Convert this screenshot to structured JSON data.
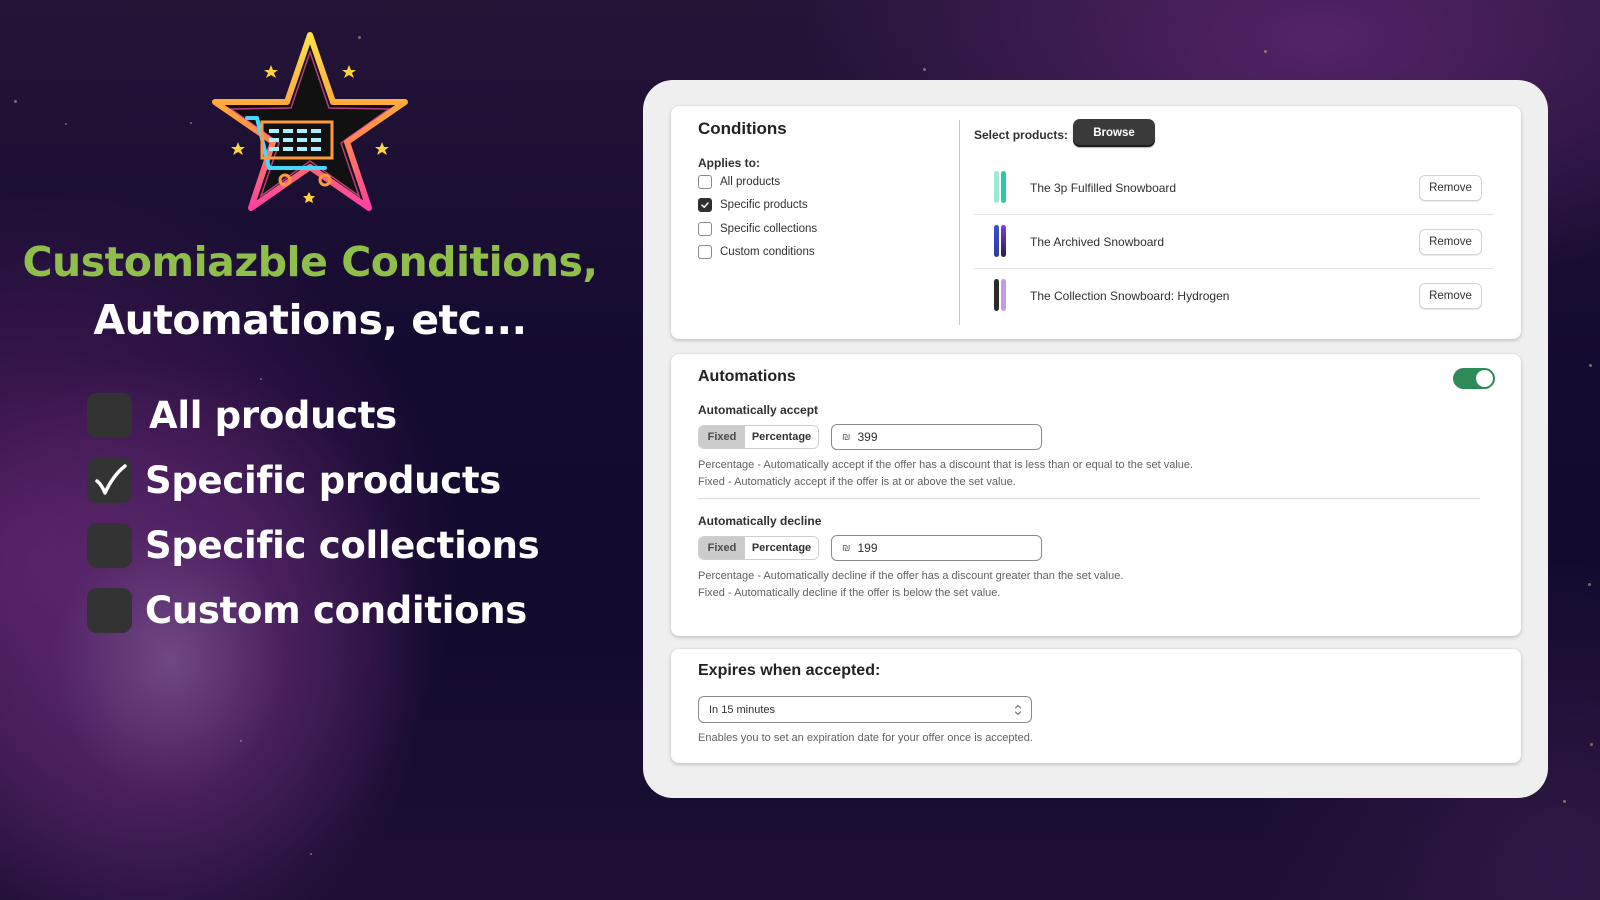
{
  "promo": {
    "headline_line1": "Customiazble Conditions,",
    "headline_line2": "Automations, etc...",
    "accent_color": "#8fbf4a",
    "items": [
      {
        "label": "All products",
        "checked": false
      },
      {
        "label": "Specific products",
        "checked": true
      },
      {
        "label": "Specific collections",
        "checked": false
      },
      {
        "label": "Custom conditions",
        "checked": false
      }
    ]
  },
  "conditions": {
    "title": "Conditions",
    "applies_to_label": "Applies to:",
    "options": [
      {
        "label": "All products",
        "checked": false
      },
      {
        "label": "Specific products",
        "checked": true
      },
      {
        "label": "Specific collections",
        "checked": false
      },
      {
        "label": "Custom conditions",
        "checked": false
      }
    ],
    "select_products_label": "Select products:",
    "browse_label": "Browse",
    "products": [
      {
        "name": "The 3p Fulfilled Snowboard",
        "remove_label": "Remove",
        "colors": [
          "#9ae8d8",
          "#2ccaa4"
        ]
      },
      {
        "name": "The Archived Snowboard",
        "remove_label": "Remove",
        "colors": [
          "#3a4fc9",
          "#5a2fb0"
        ]
      },
      {
        "name": "The Collection Snowboard: Hydrogen",
        "remove_label": "Remove",
        "colors": [
          "#2b2b2b",
          "#c79ae3"
        ]
      }
    ]
  },
  "automations": {
    "title": "Automations",
    "enabled": true,
    "toggle_color": "#2e8b57",
    "accept": {
      "label": "Automatically accept",
      "mode_options": [
        "Fixed",
        "Percentage"
      ],
      "selected_mode": "Fixed",
      "currency_symbol": "₪",
      "value": "399",
      "help_line1": "Percentage - Automatically accept if the offer has a discount that is less than or equal to the set value.",
      "help_line2": "Fixed - Automaticly accept if the offer is at or above the set value."
    },
    "decline": {
      "label": "Automatically decline",
      "mode_options": [
        "Fixed",
        "Percentage"
      ],
      "selected_mode": "Fixed",
      "currency_symbol": "₪",
      "value": "199",
      "help_line1": "Percentage - Automatically decline if the offer has a discount greater than the set value.",
      "help_line2": "Fixed - Automatically decline if the offer is below the set value."
    }
  },
  "expiry": {
    "title": "Expires when accepted:",
    "selected_value": "In 15 minutes",
    "help": "Enables you to set an expiration date for your offer once is accepted."
  }
}
